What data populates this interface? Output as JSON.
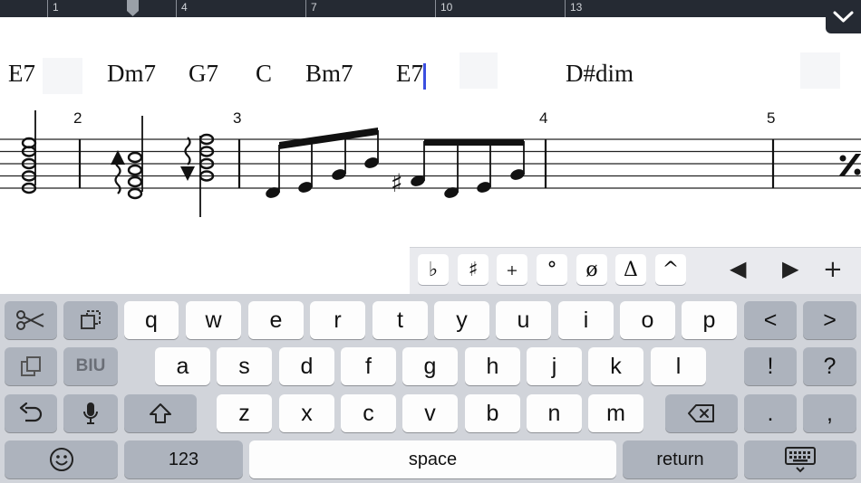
{
  "ruler": {
    "labels": [
      "1",
      "4",
      "7",
      "10",
      "13"
    ]
  },
  "chords": [
    "E7",
    "Dm7",
    "G7",
    "C",
    "Bm7",
    "E7",
    "D#dim"
  ],
  "measures": [
    "2",
    "3",
    "4",
    "5"
  ],
  "toolbar": {
    "flat": "♭",
    "sharp": "♯",
    "plus": "+",
    "dim": "°",
    "halfdim": "ø",
    "maj": "Δ",
    "caret": "^",
    "prev": "◀",
    "next": "▶",
    "add": "+"
  },
  "keyboard": {
    "row1": [
      "q",
      "w",
      "e",
      "r",
      "t",
      "y",
      "u",
      "i",
      "o",
      "p"
    ],
    "row2": [
      "a",
      "s",
      "d",
      "f",
      "g",
      "h",
      "j",
      "k",
      "l"
    ],
    "row3": [
      "z",
      "x",
      "c",
      "v",
      "b",
      "n",
      "m"
    ],
    "left_arrow": "<",
    "right_arrow": ">",
    "exclaim": "!",
    "question": "?",
    "period": ".",
    "comma": ",",
    "biu": "BIU",
    "numbers": "123",
    "space": "space",
    "return": "return"
  }
}
